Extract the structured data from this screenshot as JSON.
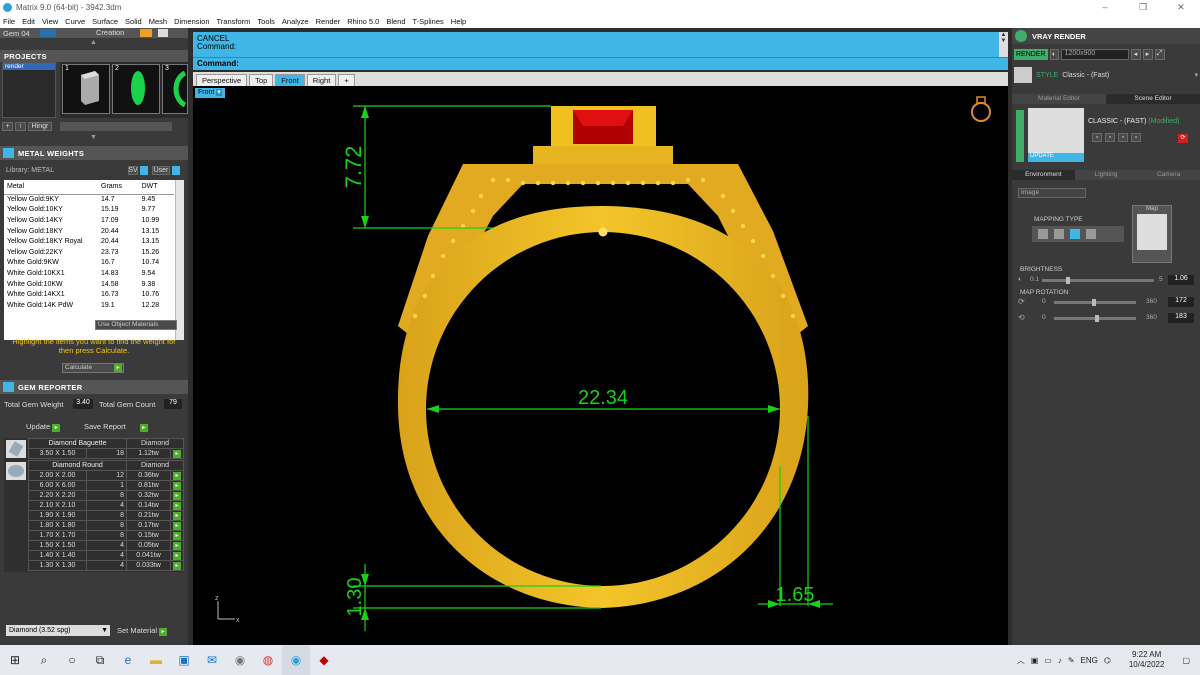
{
  "window": {
    "title": "Matrix 9.0 (64-bit) - 3942.3dm",
    "controls": [
      "–",
      "❐",
      "✕"
    ]
  },
  "menu": [
    "File",
    "Edit",
    "View",
    "Curve",
    "Surface",
    "Solid",
    "Mesh",
    "Dimension",
    "Transform",
    "Tools",
    "Analyze",
    "Render",
    "Rhino 5.0",
    "Blend",
    "T-Splines",
    "Help"
  ],
  "topbar": {
    "gem_label": "Gem 04",
    "creation_label": "Creation"
  },
  "projects": {
    "title": "PROJECTS",
    "item": "render",
    "thumbs": [
      "1",
      "2",
      "3"
    ],
    "hinge_label": "Hingr"
  },
  "metal": {
    "title": "METAL WEIGHTS",
    "library_label": "Library: METAL",
    "sv_label": "SV",
    "user_label": "User",
    "headers": [
      "Metal",
      "Grams",
      "DWT"
    ],
    "rows": [
      [
        "Yellow Gold:9KY",
        "14.7",
        "9.45"
      ],
      [
        "Yellow Gold:10KY",
        "15.19",
        "9.77"
      ],
      [
        "Yellow Gold:14KY",
        "17.09",
        "10.99"
      ],
      [
        "Yellow Gold:18KY",
        "20.44",
        "13.15"
      ],
      [
        "Yellow Gold:18KY Royal",
        "20.44",
        "13.15"
      ],
      [
        "Yellow Gold:22KY",
        "23.73",
        "15.26"
      ],
      [
        "White Gold:9KW",
        "16.7",
        "10.74"
      ],
      [
        "White Gold:10KX1",
        "14.83",
        "9.54"
      ],
      [
        "White Gold:10KW",
        "14.58",
        "9.38"
      ],
      [
        "White Gold:14KX1",
        "16.73",
        "10.76"
      ],
      [
        "White Gold:14K PdW",
        "19.1",
        "12.28"
      ]
    ],
    "use_obj_label": "Use Object Materials",
    "hint": "Highlight the items you want to find the weight for then press Calculate.",
    "calculate_label": "Calculate"
  },
  "gem": {
    "title": "GEM REPORTER",
    "total_weight_label": "Total Gem Weight",
    "total_weight": "3.40",
    "total_count_label": "Total Gem Count",
    "total_count": "79",
    "update_label": "Update",
    "save_label": "Save Report",
    "baguette": {
      "name": "Diamond Baguette",
      "type": "Diamond",
      "rows": [
        [
          "3.50 X 1.50",
          "18",
          "1.12tw"
        ]
      ]
    },
    "round": {
      "name": "Diamond Round",
      "type": "Diamond",
      "rows": [
        [
          "2.00 X 2.00",
          "12",
          "0.36tw"
        ],
        [
          "6.00 X 6.00",
          "1",
          "0.81tw"
        ],
        [
          "2.20 X 2.20",
          "8",
          "0.32tw"
        ],
        [
          "2.10 X 2.10",
          "4",
          "0.14tw"
        ],
        [
          "1.90 X 1.90",
          "8",
          "0.21tw"
        ],
        [
          "1.80 X 1.80",
          "8",
          "0.17tw"
        ],
        [
          "1.70 X 1.70",
          "8",
          "0.15tw"
        ],
        [
          "1.50 X 1.50",
          "4",
          "0.05tw"
        ],
        [
          "1.40 X 1.40",
          "4",
          "0.041tw"
        ],
        [
          "1.30 X 1.30",
          "4",
          "0.033tw"
        ]
      ]
    },
    "material_select": "Diamond (3.52 spg)",
    "set_material_label": "Set Material"
  },
  "command": {
    "line1": "CANCEL",
    "line2": "Command:",
    "input": "Command:"
  },
  "view_tabs": [
    "Perspective",
    "Top",
    "Front",
    "Right",
    "+"
  ],
  "active_view_label": "Front",
  "dims": {
    "top": "7.72",
    "diameter": "22.34",
    "bottom": "1.30",
    "right": "1.65"
  },
  "axis": {
    "z": "z",
    "x": "x"
  },
  "vray": {
    "title": "VRAY RENDER",
    "render_label": "RENDER",
    "resolution": "1200x900",
    "style_label": "STYLE",
    "style_value": "Classic - (Fast)",
    "tabs": [
      "Material Editor",
      "Scene Editor"
    ],
    "scene_name": "CLASSIC - (FAST)",
    "modified": "(Modified)",
    "update_label": "UPDATE",
    "env_tabs": [
      "Environment",
      "Lighting",
      "Camera"
    ],
    "image_select": "Image",
    "mapping_label": "MAPPING TYPE",
    "map_label": "Map",
    "brightness_label": "BRIGHTNESS",
    "brightness_min": "0.1",
    "brightness_max": "5",
    "brightness_val": "1.06",
    "rotation_label": "MAP ROTATION",
    "rot1_min": "0",
    "rot1_max": "360",
    "rot1_val": "172",
    "rot2_min": "0",
    "rot2_max": "360",
    "rot2_val": "183"
  },
  "taskbar": {
    "time": "9:22 AM",
    "date": "10/4/2022",
    "lang": "ENG"
  }
}
